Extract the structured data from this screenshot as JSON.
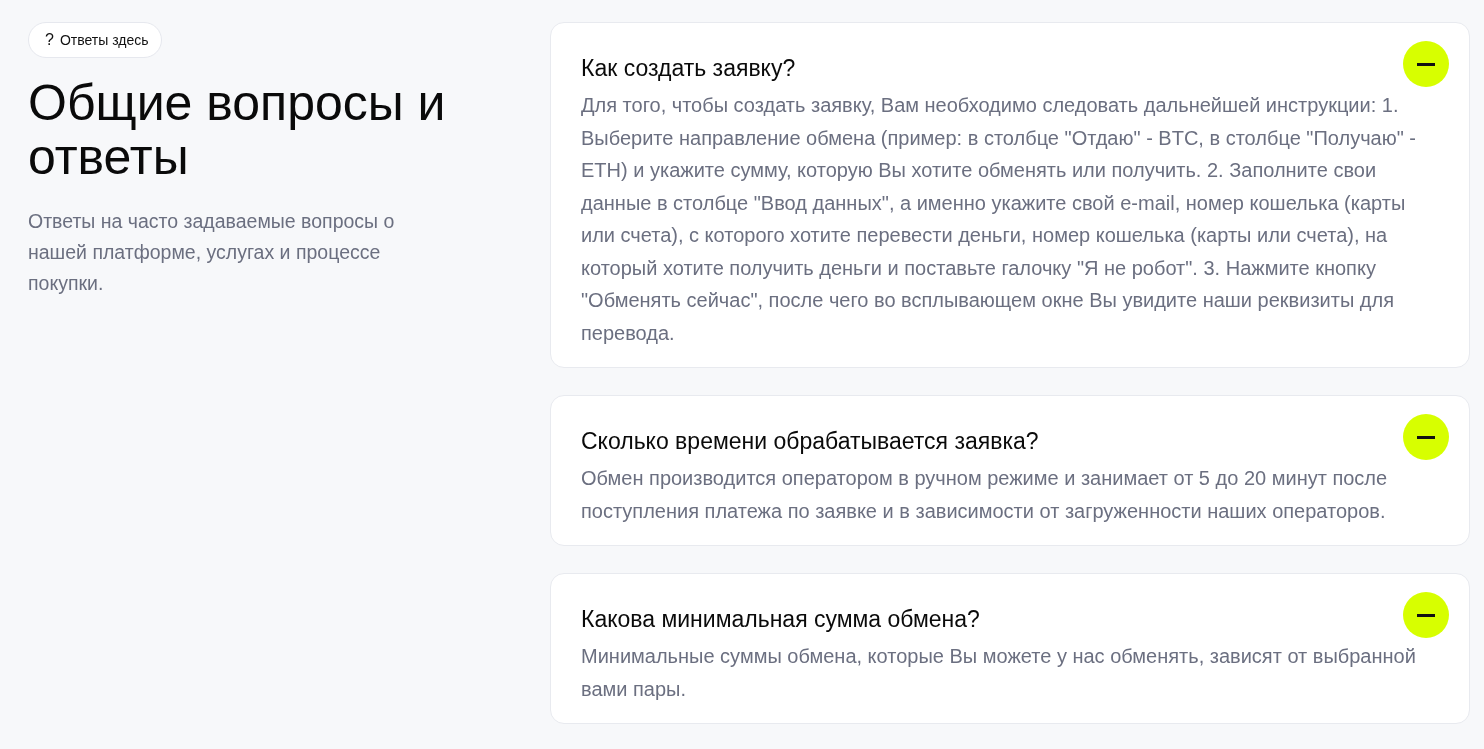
{
  "badge": {
    "icon": "?",
    "label": "Ответы здесь"
  },
  "heading": "Общие вопросы и ответы",
  "subtitle": "Ответы на часто задаваемые вопросы о нашей платформе, услугах и процессе покупки.",
  "faq": [
    {
      "question": "Как создать заявку?",
      "expanded": true,
      "answer": "Для того, чтобы создать заявку, Вам необходимо следовать дальнейшей инструкции: 1. Выберите направление обмена (пример: в столбце \"Отдаю\" - BTC, в столбце \"Получаю\" - ETH) и укажите сумму, которую Вы хотите обменять или получить. 2. Заполните свои данные в столбце \"Ввод данных\", а именно укажите свой e-mail, номер кошелька (карты или счета), с которого хотите перевести деньги, номер кошелька (карты или счета), на который хотите получить деньги и поставьте галочку \"Я не робот\". 3. Нажмите кнопку \"Обменять сейчас\", после чего во всплывающем окне Вы увидите наши реквизиты для перевода."
    },
    {
      "question": "Сколько времени обрабатывается заявка?",
      "expanded": true,
      "answer": "Обмен производится оператором в ручном режиме и занимает от 5 до 20 минут после поступления платежа по заявке и в зависимости от загруженности наших операторов."
    },
    {
      "question": "Какова минимальная сумма обмена?",
      "expanded": true,
      "answer": "Минимальные суммы обмена, которые Вы можете у нас обменять, зависят от выбранной вами пары."
    }
  ]
}
